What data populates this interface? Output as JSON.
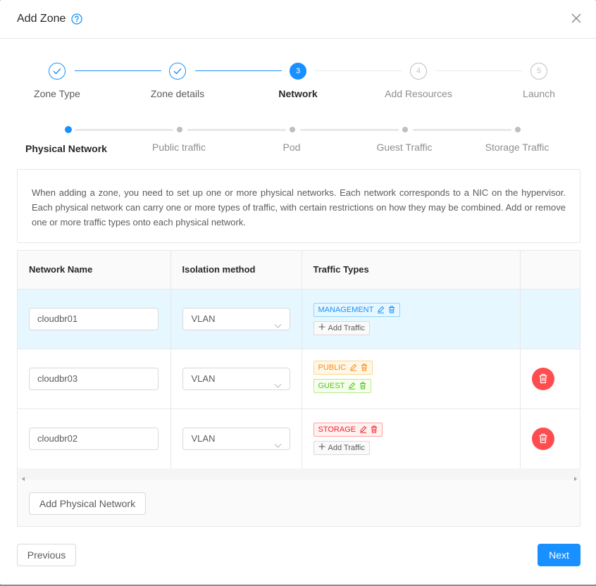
{
  "modal": {
    "title": "Add Zone"
  },
  "steps": [
    {
      "label": "Zone Type",
      "status": "done",
      "number": "1"
    },
    {
      "label": "Zone details",
      "status": "done",
      "number": "2"
    },
    {
      "label": "Network",
      "status": "active",
      "number": "3"
    },
    {
      "label": "Add Resources",
      "status": "wait",
      "number": "4"
    },
    {
      "label": "Launch",
      "status": "wait",
      "number": "5"
    }
  ],
  "substeps": [
    {
      "label": "Physical Network",
      "status": "active"
    },
    {
      "label": "Public traffic",
      "status": "wait"
    },
    {
      "label": "Pod",
      "status": "wait"
    },
    {
      "label": "Guest Traffic",
      "status": "wait"
    },
    {
      "label": "Storage Traffic",
      "status": "wait"
    }
  ],
  "description": "When adding a zone, you need to set up one or more physical networks. Each network corresponds to a NIC on the hypervisor. Each physical network can carry one or more types of traffic, with certain restrictions on how they may be combined. Add or remove one or more traffic types onto each physical network.",
  "table": {
    "headers": {
      "name": "Network Name",
      "isolation": "Isolation method",
      "traffic": "Traffic Types"
    },
    "rows": [
      {
        "name": "cloudbr01",
        "isolation": "VLAN",
        "traffic": [
          {
            "label": "MANAGEMENT",
            "color": "blue"
          }
        ],
        "add_traffic": "Add Traffic",
        "deletable": false
      },
      {
        "name": "cloudbr03",
        "isolation": "VLAN",
        "traffic": [
          {
            "label": "PUBLIC",
            "color": "orange"
          },
          {
            "label": "GUEST",
            "color": "green"
          }
        ],
        "deletable": true
      },
      {
        "name": "cloudbr02",
        "isolation": "VLAN",
        "traffic": [
          {
            "label": "STORAGE",
            "color": "red"
          }
        ],
        "add_traffic": "Add Traffic",
        "deletable": true
      }
    ]
  },
  "buttons": {
    "add_physical_network": "Add Physical Network",
    "previous": "Previous",
    "next": "Next"
  },
  "colors": {
    "primary": "#1890ff",
    "danger": "#ff4d4f"
  }
}
